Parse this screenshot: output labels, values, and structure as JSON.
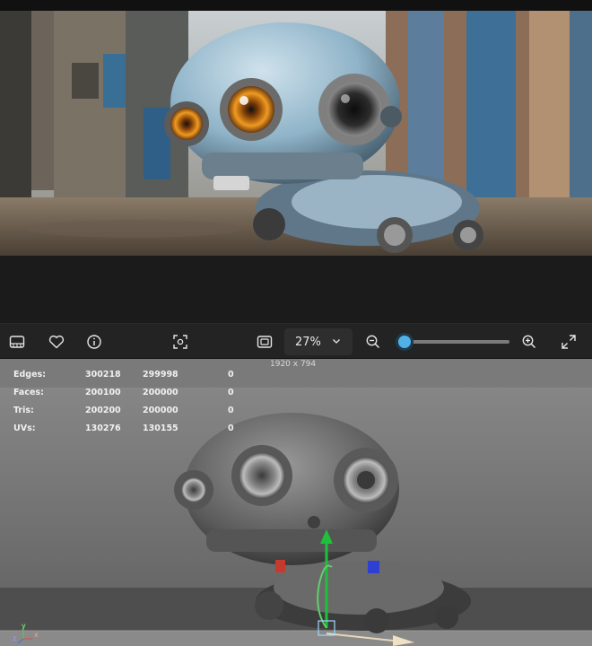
{
  "toolbar": {
    "zoom_value": "27%",
    "zoom_fraction": 0.07,
    "icons": [
      "filmstrip-icon",
      "heart-icon",
      "info-icon",
      "focus-icon",
      "fit-screen-icon",
      "chevron-down-icon",
      "zoom-out-icon",
      "zoom-in-icon",
      "fullscreen-icon"
    ]
  },
  "viewport": {
    "resolution": "1920 x 794",
    "axis_x": "x",
    "axis_y": "y",
    "axis_z": "z",
    "stats": [
      {
        "label": "Edges:",
        "a": "300218",
        "b": "299998",
        "c": "0"
      },
      {
        "label": "Faces:",
        "a": "200100",
        "b": "200000",
        "c": "0"
      },
      {
        "label": "Tris:",
        "a": "200200",
        "b": "200000",
        "c": "0"
      },
      {
        "label": "UVs:",
        "a": "130276",
        "b": "130155",
        "c": "0"
      }
    ]
  },
  "colors": {
    "accent": "#4fb1e8",
    "toolbar_bg": "#232323",
    "viewport_bg": "#7c7c7c"
  }
}
